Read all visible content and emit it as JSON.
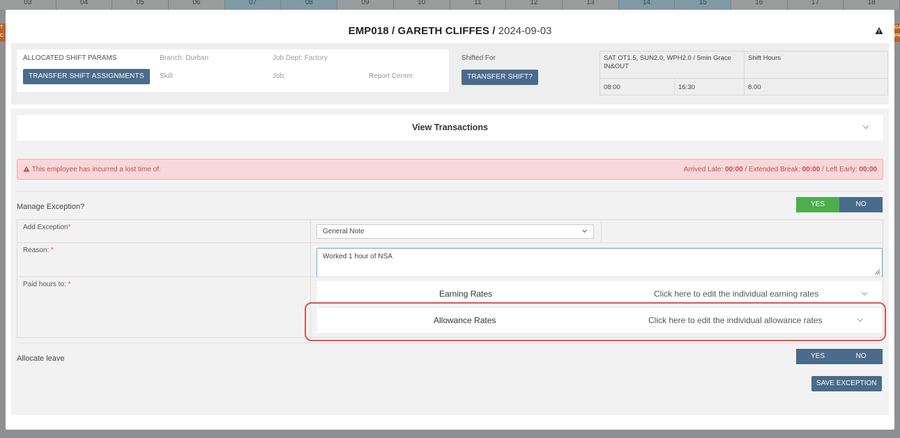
{
  "background": {
    "dates": [
      "03",
      "04",
      "05",
      "06",
      "07",
      "08",
      "09",
      "10",
      "11",
      "12",
      "13",
      "14",
      "15",
      "16",
      "17",
      "18"
    ],
    "highlighted": [
      4,
      5,
      11,
      12
    ],
    "left_edge_text": "T C\nUN",
    "right_edge_text": "GA\nPAS"
  },
  "modal": {
    "employee": "EMP018 / GARETH CLIFFES /",
    "date": "2024-09-03",
    "params": {
      "allocated_label": "ALLOCATED SHIFT PARAMS",
      "transfer_assignments_button": "TRANSFER SHIFT ASSIGNMENTS",
      "branch": "Branch: Durban",
      "job_dept": "Job Dept: Factory",
      "skill": "Skill:",
      "job": "Job:",
      "report_center": "Report Center:",
      "shifted_for": "Shifted For",
      "transfer_shift_button": "TRANSFER SHIFT?",
      "shift_desc": "SAT OT1.5, SUN2.0, WPH2.0 / 5min Grace IN&OUT",
      "shift_hours_label": "Shift Hours",
      "start": "08:00",
      "end": "16:30",
      "hours": "8.00"
    },
    "view_transactions": "View Transactions",
    "alert": {
      "message": "This employee has incurred a lost time of:",
      "arrived_late_label": "Arrived Late:",
      "arrived_late": "00:00",
      "extended_break_label": "/ Extended Break:",
      "extended_break": "00:00",
      "left_early_label": "/ Left Early:",
      "left_early": "00:00"
    },
    "manage_exception": {
      "label": "Manage Exception?",
      "yes": "YES",
      "no": "NO",
      "selected": "YES"
    },
    "form": {
      "add_exception_label": "Add Exception",
      "add_exception_value": "General Note",
      "reason_label": "Reason:",
      "reason_value": "Worked 1 hour of NSA",
      "paid_hours_label": "Paid hours to:",
      "earning_rates_title": "Earning Rates",
      "earning_rates_hint": "Click here to edit the individual earning rates",
      "allowance_rates_title": "Allowance Rates",
      "allowance_rates_hint": "Click here to edit the individual allowance rates"
    },
    "allocate_leave": {
      "label": "Allocate leave",
      "yes": "YES",
      "no": "NO"
    },
    "save_button": "SAVE EXCEPTION"
  },
  "colors": {
    "steel": "#4a6b8a",
    "yes_green": "#4cae4c",
    "alert_bg": "#f8d7da",
    "alert_text": "#c0504d",
    "highlight_red": "#d9534f"
  }
}
